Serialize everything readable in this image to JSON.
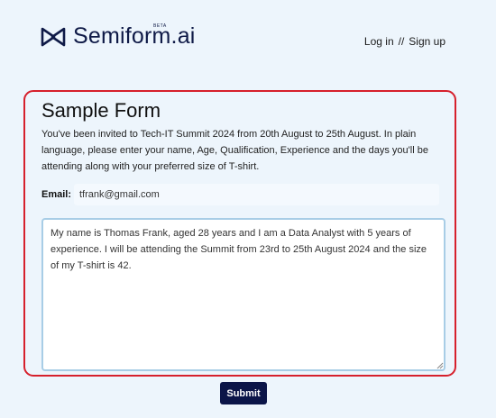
{
  "header": {
    "brand_name": "Semiform.ai",
    "brand_badge": "BETA",
    "logo_icon": "bowtie-logo-icon",
    "login_label": "Log in",
    "separator": "//",
    "signup_label": "Sign up"
  },
  "form": {
    "title": "Sample Form",
    "description": "You've been invited to Tech-IT Summit 2024 from 20th August to 25th August. In plain language, please enter your name, Age, Qualification, Experience and the days you'll be attending along with your preferred size of T-shirt.",
    "email_label": "Email:",
    "email_value": "tfrank@gmail.com",
    "message_value": "My name is Thomas Frank, aged 28 years and I am a Data Analyst with 5 years of experience. I will be attending the Summit from 23rd to 25th August 2024 and the size of my T-shirt is 42.",
    "submit_label": "Submit"
  },
  "colors": {
    "background": "#edf5fc",
    "brand": "#0f1a47",
    "card_border": "#d6202c",
    "submit_bg": "#0b1548",
    "textarea_border": "#a8cde6"
  }
}
